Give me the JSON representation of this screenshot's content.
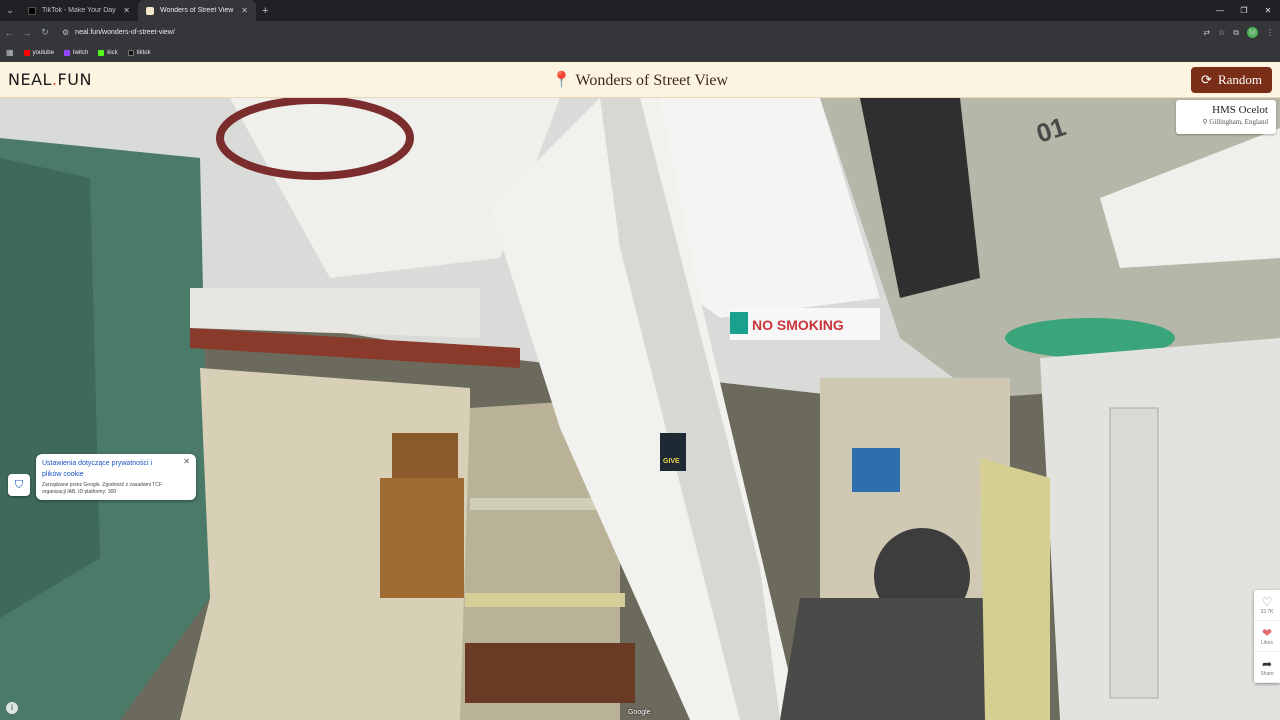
{
  "browser": {
    "tabs": [
      {
        "label": "TikTok - Make Your Day",
        "active": false
      },
      {
        "label": "Wonders of Street View",
        "active": true
      }
    ],
    "url": "neal.fun/wonders-of-street-view/",
    "bookmarks": [
      {
        "label": "youtube",
        "color": "#ff0000"
      },
      {
        "label": "twitch",
        "color": "#9146ff"
      },
      {
        "label": "kick",
        "color": "#53fc18"
      },
      {
        "label": "tiktok",
        "color": "#111111"
      }
    ],
    "profile_initial": "M"
  },
  "site": {
    "logo_left": "NEAL",
    "logo_dot": ".",
    "logo_right": "FUN",
    "title": "Wonders of Street View",
    "random_label": "Random"
  },
  "location": {
    "name": "HMS Ocelot",
    "place": "Gillingham, England"
  },
  "cookie": {
    "title": "Ustawienia dotyczące prywatności i plików cookie",
    "description": "Zarządzane przez Google. Zgodność z zasadami TCF organizacji IAB. ID platformy: 300"
  },
  "actions": {
    "likes_count": "33.7K",
    "likes_label": "Likes",
    "share_label": "Share"
  },
  "scene": {
    "sign_text": "NO SMOKING",
    "poster_text": "ALL ABOARD PLEASE GIVE",
    "hull_number": "01"
  },
  "attribution": "Google"
}
